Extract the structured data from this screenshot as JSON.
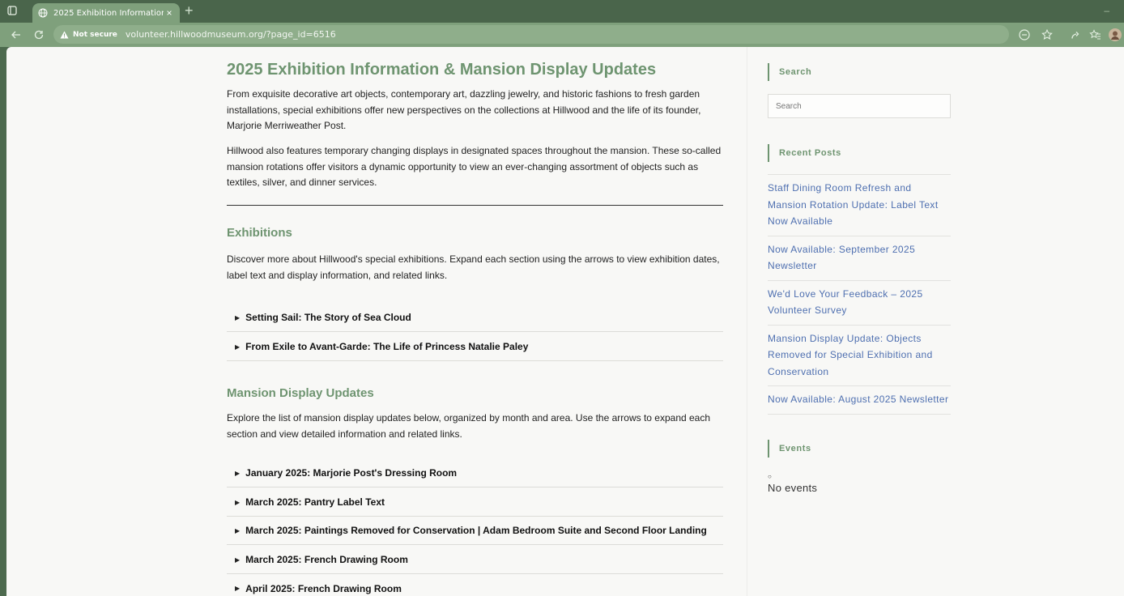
{
  "browser": {
    "tab_title": "2025 Exhibition Information & M",
    "tab_close": "×",
    "new_tab": "+",
    "minimize": "–",
    "security_label": "Not secure",
    "url": "volunteer.hillwoodmuseum.org/?page_id=6516"
  },
  "page": {
    "title": "2025 Exhibition Information & Mansion Display Updates",
    "intro_paragraphs": [
      "From exquisite decorative art objects, contemporary art, dazzling jewelry, and historic fashions to fresh garden installations, special exhibitions offer new perspectives on the collections at Hillwood and the life of its founder, Marjorie Merriweather Post.",
      "Hillwood also features temporary changing displays in designated spaces throughout the mansion. These so-called mansion rotations offer visitors a dynamic opportunity to view an ever-changing assortment of objects such as textiles, silver, and dinner services."
    ],
    "exhibitions": {
      "heading": "Exhibitions",
      "description": "Discover more about Hillwood's special exhibitions. Expand each section using the arrows to view exhibition dates, label text and display information, and related links.",
      "items": [
        "Setting Sail: The Story of Sea Cloud",
        "From Exile to Avant-Garde: The Life of Princess Natalie Paley"
      ]
    },
    "mansion_updates": {
      "heading": "Mansion Display Updates",
      "description": "Explore the list of mansion display updates below, organized by month and area. Use the arrows to expand each section and view detailed information and related links.",
      "items": [
        "January 2025: Marjorie Post's Dressing Room",
        "March 2025: Pantry Label Text",
        "March 2025: Paintings Removed for Conservation | Adam Bedroom Suite and Second Floor Landing",
        "March 2025: French Drawing Room",
        "April 2025: French Drawing Room"
      ]
    },
    "accordion_arrow": "▶"
  },
  "sidebar": {
    "search_title": "Search",
    "search_placeholder": "Search",
    "recent_posts_title": "Recent Posts",
    "recent_posts": [
      "Staff Dining Room Refresh and Mansion Rotation Update: Label Text Now Available",
      "Now Available: September 2025 Newsletter",
      "We'd Love Your Feedback – 2025 Volunteer Survey",
      "Mansion Display Update: Objects Removed for Special Exhibition and Conservation",
      "Now Available: August 2025 Newsletter"
    ],
    "events_title": "Events",
    "events_bullet": "○",
    "no_events": "No events"
  },
  "colors": {
    "accent_green": "#6e9470",
    "link_blue": "#4e6fb0",
    "chrome_dark": "#4a654b",
    "chrome_light": "#7fa07c"
  },
  "icons": [
    "window-icon",
    "globe-icon",
    "back-icon",
    "reload-icon",
    "warning-icon",
    "reading-mode-icon",
    "star-icon",
    "extension-icon",
    "favorites-icon",
    "profile-avatar"
  ]
}
